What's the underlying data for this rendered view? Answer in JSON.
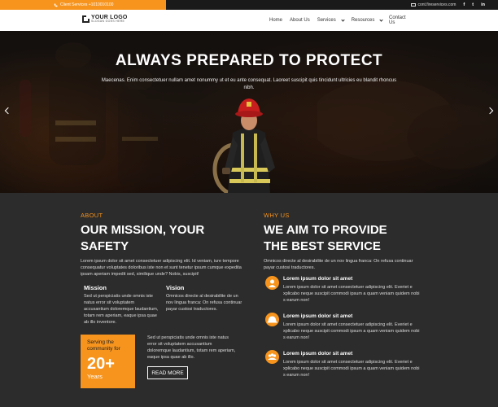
{
  "topbar": {
    "phone": "Client Services +1010010100",
    "email": "cont.fireservices.com",
    "social": [
      "f",
      "t",
      "in"
    ]
  },
  "header": {
    "logo_title": "YOUR LOGO",
    "logo_slogan": "SLOGAN GOES HERE",
    "nav": [
      {
        "label": "Home"
      },
      {
        "label": "About Us"
      },
      {
        "label": "Services"
      },
      {
        "label": "Resources"
      },
      {
        "label": "Contact Us"
      }
    ]
  },
  "hero": {
    "title": "ALWAYS PREPARED TO PROTECT",
    "text": "Maecenas. Enim consectetuer nullam amet nonummy ut et eu ante consequat. Laoreet suscipit quis tincidunt ultricies eu blandit rhoncus nibh."
  },
  "about": {
    "eyebrow": "ABOUT",
    "title_line1": "OUR MISSION, YOUR",
    "title_line2": "SAFETY",
    "text": "Lorem ipsum dolor sit amet consectetuer adipiscing elit. Id veniam, iure tempore consequatur voluptates doloribus iste non et sunt tenetur ipsum cumque expedita ipsam aperiam impedit sed, similique unde? Nobis, suscipit!",
    "mission_title": "Mission",
    "mission_text": "Sed ut perspiciatis unde omnis iste natus error sit voluptatem accusantium doloremque laudantium, totam rem aperiam, eaque ipsa quae ab illo inventore.",
    "vision_title": "Vision",
    "vision_text": "Omnicos directe al desirabilite de un nov lingua franca: On refusa continuar payar custosi traductores.",
    "stat_label_line1": "Serving the",
    "stat_label_line2": "community for",
    "stat_number": "20+",
    "stat_unit": "Years",
    "stat_text": "Sed ut perspiciatis unde omnis iste natus error sit voluptatem accusantium doloremque laudantium, totam rem aperiam, eaque ipsa quae ab illo.",
    "read_more": "READ MORE"
  },
  "why": {
    "eyebrow": "WHY US",
    "title_line1": "WE AIM TO PROVIDE",
    "title_line2": "THE BEST SERVICE",
    "text": "Omnicos directe al desirabilite de un nov lingua franca: On refusa continuar payar custosi traductores.",
    "features": [
      {
        "title": "Lorem ipsum dolor sit amet",
        "text": "Lorem ipsum dolor sit amet consectetuer adipiscing elit. Everiet e xplicabo neque suscipit commodi ipsum a quam veniam quidem nobi s earum non!",
        "icon": "firefighter-icon"
      },
      {
        "title": "Lorem ipsum dolor sit amet",
        "text": "Lorem ipsum dolor sit amet consectetuer adipiscing elit. Everiet e xplicabo neque suscipit commodi ipsum a quam veniam quidem nobi s earum non!",
        "icon": "helmet-icon"
      },
      {
        "title": "Lorem ipsum dolor sit amet",
        "text": "Lorem ipsum dolor sit amet consectetuer adipiscing elit. Everiet e xplicabo neque suscipit commodi ipsum a quam veniam quidem nobi s earum non!",
        "icon": "team-icon"
      }
    ]
  },
  "colors": {
    "accent": "#f7941d",
    "dark": "#2c2c2c",
    "topbar": "#1a1a1a"
  }
}
